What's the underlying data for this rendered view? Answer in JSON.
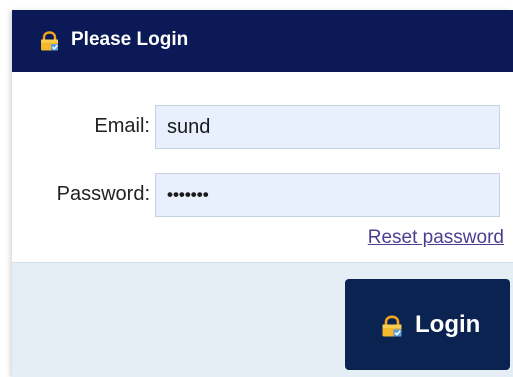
{
  "header": {
    "icon": "lock-icon",
    "title": "Please Login"
  },
  "form": {
    "email_label": "Email:",
    "email_value": "sund",
    "password_label": "Password:",
    "password_value": "•••••••",
    "reset_link": "Reset password"
  },
  "footer": {
    "login_icon": "lock-icon",
    "login_label": "Login"
  },
  "colors": {
    "header_bg": "#0b1957",
    "button_bg": "#0b2350",
    "footer_bg": "#e5edf5",
    "input_bg": "#e8f0fe",
    "link": "#4b3f92"
  }
}
